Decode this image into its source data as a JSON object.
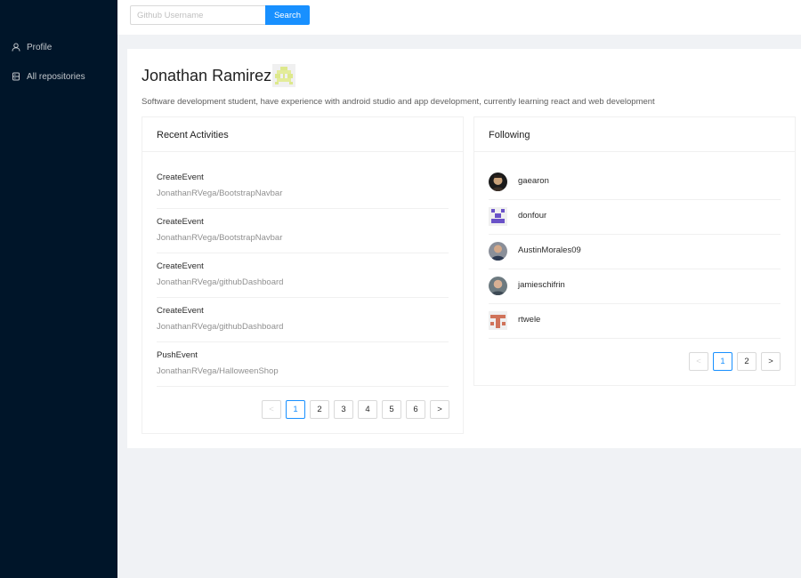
{
  "sidebar": {
    "items": [
      {
        "label": "Profile",
        "icon": "user-icon"
      },
      {
        "label": "All repositories",
        "icon": "database-icon"
      }
    ]
  },
  "search": {
    "placeholder": "Github Username",
    "value": "",
    "button_label": "Search"
  },
  "profile": {
    "name": "Jonathan Ramirez",
    "bio": "Software development student, have experience with android studio and app development, currently learning react and web development"
  },
  "activities": {
    "title": "Recent Activities",
    "items": [
      {
        "type": "CreateEvent",
        "repo": "JonathanRVega/BootstrapNavbar"
      },
      {
        "type": "CreateEvent",
        "repo": "JonathanRVega/BootstrapNavbar"
      },
      {
        "type": "CreateEvent",
        "repo": "JonathanRVega/githubDashboard"
      },
      {
        "type": "CreateEvent",
        "repo": "JonathanRVega/githubDashboard"
      },
      {
        "type": "PushEvent",
        "repo": "JonathanRVega/HalloweenShop"
      }
    ],
    "pagination": {
      "prev": "<",
      "pages": [
        "1",
        "2",
        "3",
        "4",
        "5",
        "6"
      ],
      "next": ">",
      "current": "1"
    }
  },
  "following": {
    "title": "Following",
    "items": [
      {
        "login": "gaearon"
      },
      {
        "login": "donfour"
      },
      {
        "login": "AustinMorales09"
      },
      {
        "login": "jamieschifrin"
      },
      {
        "login": "rtwele"
      }
    ],
    "pagination": {
      "prev": "<",
      "pages": [
        "1",
        "2"
      ],
      "next": ">",
      "current": "1"
    }
  },
  "colors": {
    "sider": "#001529",
    "primary": "#1890ff",
    "background": "#f0f2f5"
  }
}
